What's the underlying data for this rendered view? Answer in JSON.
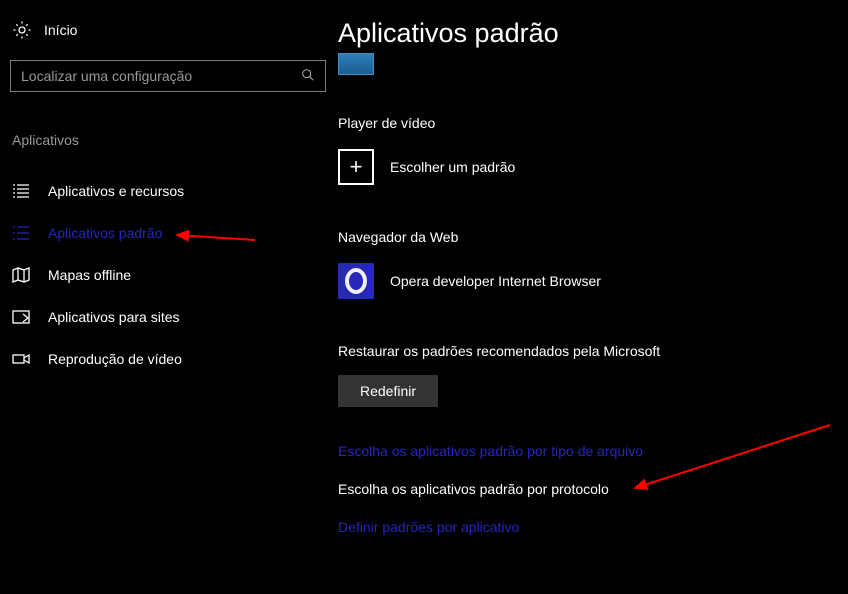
{
  "sidebar": {
    "home_label": "Início",
    "search_placeholder": "Localizar uma configuração",
    "section_header": "Aplicativos",
    "items": [
      {
        "label": "Aplicativos e recursos",
        "active": false
      },
      {
        "label": "Aplicativos padrão",
        "active": true
      },
      {
        "label": "Mapas offline",
        "active": false
      },
      {
        "label": "Aplicativos para sites",
        "active": false
      },
      {
        "label": "Reprodução de vídeo",
        "active": false
      }
    ]
  },
  "main": {
    "title": "Aplicativos padrão",
    "video_player": {
      "label": "Player de vídeo",
      "choose_label": "Escolher um padrão"
    },
    "browser": {
      "label": "Navegador da Web",
      "app_name": "Opera developer Internet Browser"
    },
    "reset": {
      "label": "Restaurar os padrões recomendados pela Microsoft",
      "button_label": "Redefinir"
    },
    "links": {
      "by_file_type": "Escolha os aplicativos padrão por tipo de arquivo",
      "by_protocol": "Escolha os aplicativos padrão por protocolo",
      "by_app": "Definir padrões por aplicativo"
    }
  }
}
